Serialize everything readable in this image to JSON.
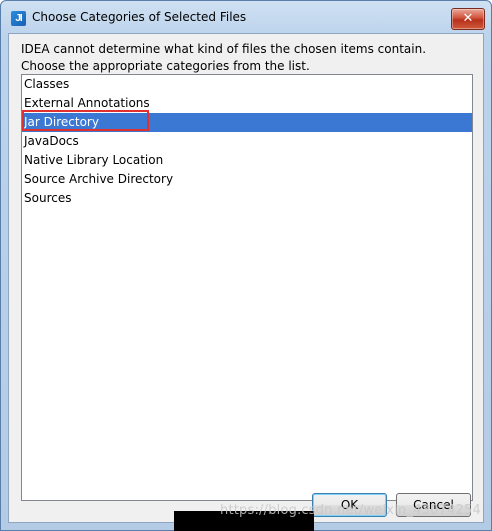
{
  "window": {
    "title": "Choose Categories of Selected Files",
    "close_glyph": "✕",
    "app_icon_text": "JI"
  },
  "message": {
    "line1": "IDEA cannot determine what kind of files the chosen items contain.",
    "line2": "Choose the appropriate categories from the list."
  },
  "list": {
    "selected_index": 2,
    "items": [
      {
        "label": "Classes"
      },
      {
        "label": "External Annotations"
      },
      {
        "label": "Jar Directory"
      },
      {
        "label": "JavaDocs"
      },
      {
        "label": "Native Library Location"
      },
      {
        "label": "Source Archive Directory"
      },
      {
        "label": "Sources"
      }
    ]
  },
  "buttons": {
    "ok": "OK",
    "cancel": "Cancel"
  },
  "watermark": {
    "text": "https://blog.csdn.net/weixin_43074254"
  },
  "colors": {
    "selection": "#3b78d4",
    "annotation_box": "#e0312f",
    "close_button": "#c8412a"
  }
}
